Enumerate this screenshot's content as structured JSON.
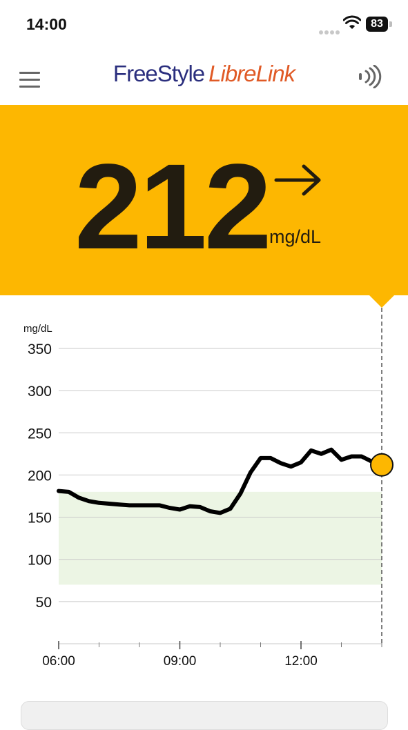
{
  "status_bar": {
    "time": "14:00",
    "battery": "83"
  },
  "header": {
    "brand_part1": "FreeStyle",
    "brand_part2": "LibreLink"
  },
  "reading": {
    "value": "212",
    "unit": "mg/dL",
    "trend": "rising-slowly / steady arrow"
  },
  "colors": {
    "reading_bg": "#fdb701",
    "target_range_fill": "#ecf5e4",
    "line": "#000000",
    "current_point": "#fdb701"
  },
  "chart_data": {
    "type": "line",
    "title": "",
    "ylabel": "mg/dL",
    "xlabel": "",
    "ylim": [
      0,
      350
    ],
    "yticks": [
      50,
      100,
      150,
      200,
      250,
      300,
      350
    ],
    "xlim": [
      6.0,
      14.0
    ],
    "xticks": [
      "06:00",
      "09:00",
      "12:00"
    ],
    "target_range": [
      70,
      180
    ],
    "series": [
      {
        "x": [
          "06:00",
          "06:15",
          "06:30",
          "06:45",
          "07:00",
          "07:15",
          "07:30",
          "07:45",
          "08:00",
          "08:15",
          "08:30",
          "08:45",
          "09:00",
          "09:15",
          "09:30",
          "09:45",
          "10:00",
          "10:15",
          "10:30",
          "10:45",
          "11:00",
          "11:15",
          "11:30",
          "11:45",
          "12:00",
          "12:15",
          "12:30",
          "12:45",
          "13:00",
          "13:15",
          "13:30",
          "13:45",
          "14:00"
        ],
        "values": [
          181,
          180,
          173,
          169,
          167,
          166,
          165,
          164,
          164,
          164,
          164,
          161,
          159,
          163,
          162,
          157,
          155,
          160,
          178,
          203,
          220,
          220,
          214,
          210,
          215,
          229,
          225,
          230,
          218,
          222,
          222,
          216,
          212
        ]
      }
    ],
    "current_point": {
      "x": "14:00",
      "value": 212
    }
  }
}
